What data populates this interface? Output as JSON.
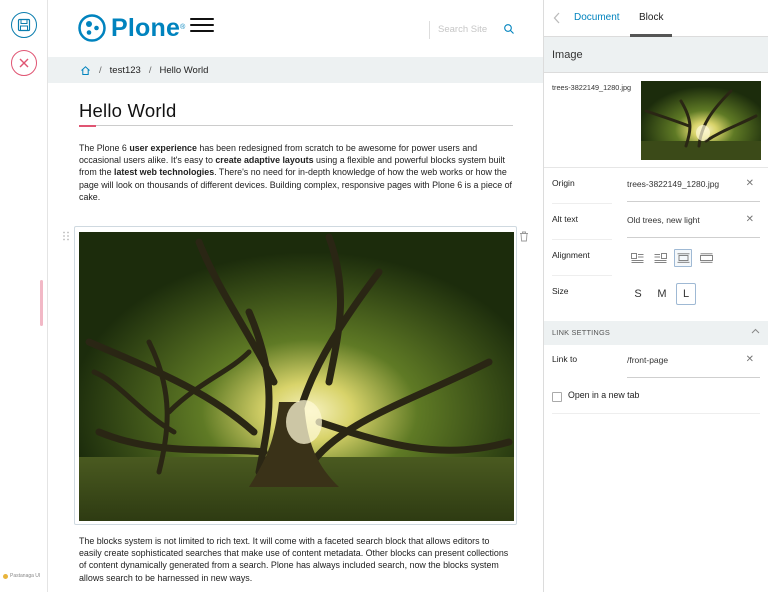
{
  "toolbar": {
    "powered_by": "Pastanaga UI"
  },
  "header": {
    "logo_text": "Plone",
    "logo_mark": "®",
    "search_placeholder": "Search Site"
  },
  "breadcrumb": {
    "items": [
      "test123",
      "Hello World"
    ]
  },
  "content": {
    "title": "Hello World",
    "para1": [
      {
        "t": "The Plone 6 ",
        "b": false
      },
      {
        "t": "user experience",
        "b": true
      },
      {
        "t": " has been redesigned from scratch to be  awesome for power users and occasional users alike. It's easy to ",
        "b": false
      },
      {
        "t": "create  adaptive layouts",
        "b": true
      },
      {
        "t": " using a flexible and powerful blocks system built from  the ",
        "b": false
      },
      {
        "t": "latest web technologies",
        "b": true
      },
      {
        "t": ". There's no need for in-depth knowledge of  how the web works or how the page will look on thousands of different  devices. Building complex,  responsive pages with Plone 6 is a piece of cake.",
        "b": false
      }
    ],
    "para2": "The blocks system is not limited to rich text. It will come with a  faceted search block that allows editors to easily create sophisticated  searches that make use of content metadata. Other blocks can present collections of content dynamically generated from a search. Plone has  always included search, now the blocks system allows search to be  harnessed in new ways."
  },
  "sidebar": {
    "tabs": [
      "Document",
      "Block"
    ],
    "active_tab": "Block",
    "section_title": "Image",
    "image_filename": "trees-3822149_1280.jpg",
    "fields": {
      "origin": {
        "label": "Origin",
        "value": "trees-3822149_1280.jpg"
      },
      "alt": {
        "label": "Alt text",
        "value": "Old trees, new light"
      },
      "alignment": {
        "label": "Alignment",
        "options": [
          "left",
          "right",
          "center",
          "full"
        ],
        "selected": "center"
      },
      "size": {
        "label": "Size",
        "options": [
          "S",
          "M",
          "L"
        ],
        "selected": "L"
      }
    },
    "link_settings": {
      "title": "LINK SETTINGS",
      "link_to": {
        "label": "Link to",
        "value": "/front-page"
      },
      "new_tab": {
        "label": "Open in a new tab",
        "checked": false
      }
    }
  },
  "colors": {
    "brand": "#0083be",
    "accent": "#e05573",
    "panel_bg": "#edf1f2"
  }
}
